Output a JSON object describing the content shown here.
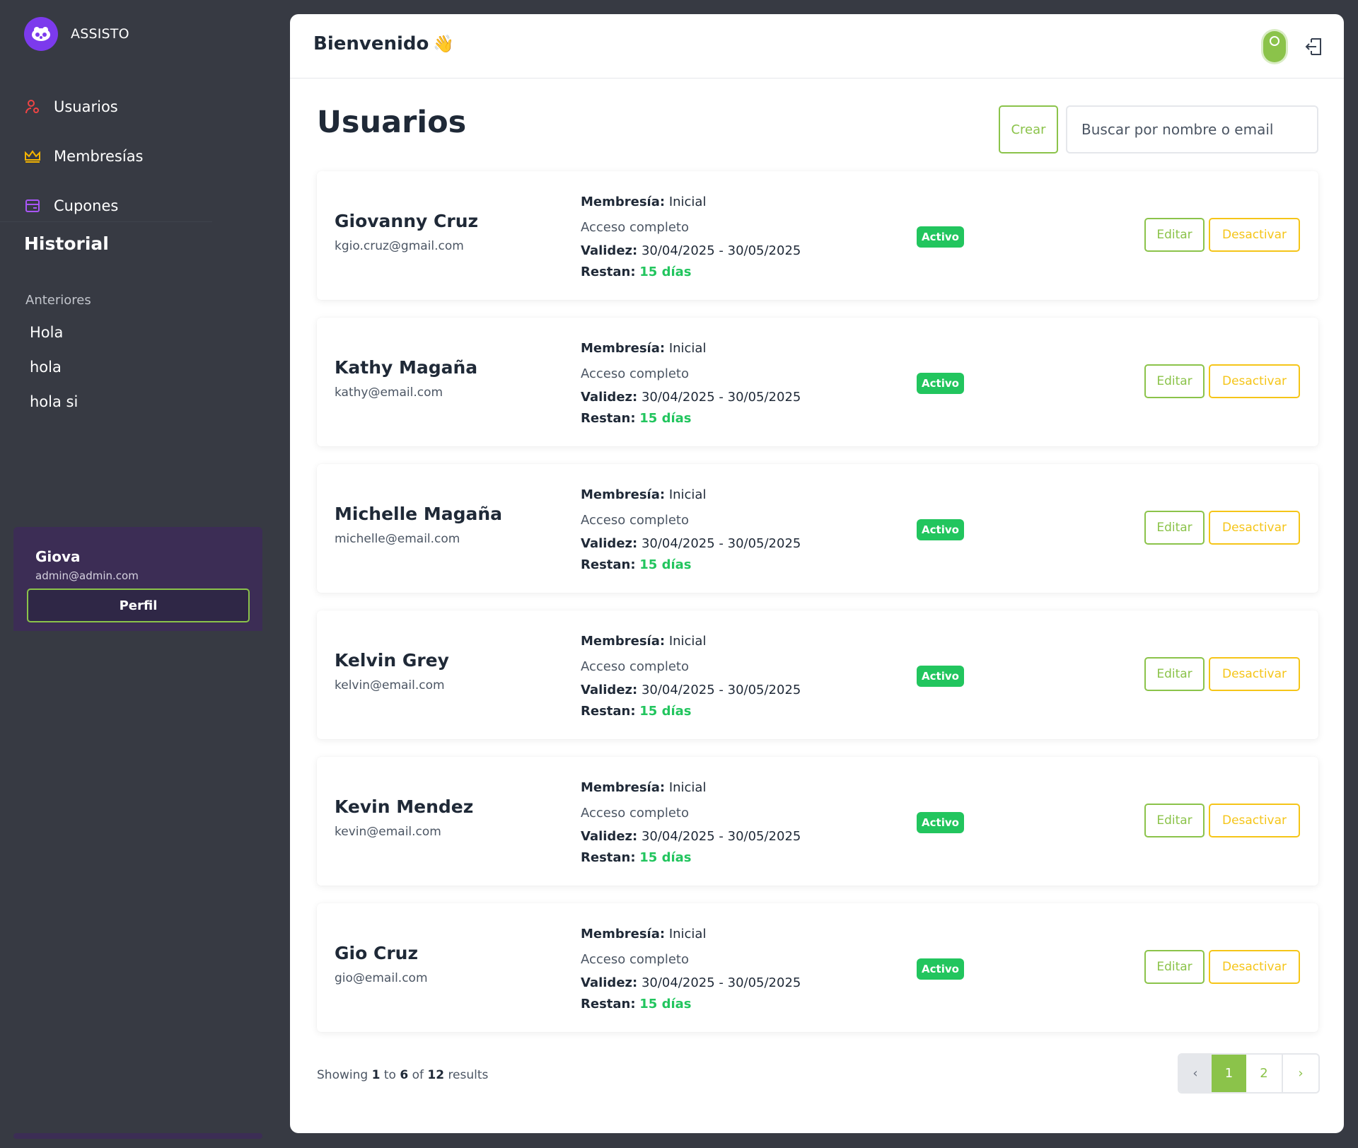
{
  "brand": {
    "name": "ASSISTO"
  },
  "sidebar": {
    "nav": [
      {
        "label": "Usuarios",
        "icon": "user-gear-icon"
      },
      {
        "label": "Membresías",
        "icon": "crown-icon"
      },
      {
        "label": "Cupones",
        "icon": "coupon-icon"
      }
    ],
    "history": {
      "title": "Historial",
      "subtitle": "Anteriores",
      "items": [
        "Hola",
        "hola",
        "hola si"
      ]
    },
    "user": {
      "name": "Giova",
      "email": "admin@admin.com",
      "profile_label": "Perfil"
    }
  },
  "header": {
    "welcome": "Bienvenido",
    "emoji": "👋"
  },
  "main": {
    "title": "Usuarios",
    "create_label": "Crear",
    "search_placeholder": "Buscar por nombre o email",
    "labels": {
      "membership": "Membresía:",
      "validity": "Validez:",
      "remaining": "Restan:",
      "edit": "Editar",
      "deactivate": "Desactivar"
    },
    "users": [
      {
        "name": "Giovanny Cruz",
        "email": "kgio.cruz@gmail.com",
        "membership": "Inicial",
        "access": "Acceso completo",
        "validity": "30/04/2025 - 30/05/2025",
        "remaining": "15 días",
        "status": "Activo"
      },
      {
        "name": "Kathy Magaña",
        "email": "kathy@email.com",
        "membership": "Inicial",
        "access": "Acceso completo",
        "validity": "30/04/2025 - 30/05/2025",
        "remaining": "15 días",
        "status": "Activo"
      },
      {
        "name": "Michelle Magaña",
        "email": "michelle@email.com",
        "membership": "Inicial",
        "access": "Acceso completo",
        "validity": "30/04/2025 - 30/05/2025",
        "remaining": "15 días",
        "status": "Activo"
      },
      {
        "name": "Kelvin Grey",
        "email": "kelvin@email.com",
        "membership": "Inicial",
        "access": "Acceso completo",
        "validity": "30/04/2025 - 30/05/2025",
        "remaining": "15 días",
        "status": "Activo"
      },
      {
        "name": "Kevin Mendez",
        "email": "kevin@email.com",
        "membership": "Inicial",
        "access": "Acceso completo",
        "validity": "30/04/2025 - 30/05/2025",
        "remaining": "15 días",
        "status": "Activo"
      },
      {
        "name": "Gio Cruz",
        "email": "gio@email.com",
        "membership": "Inicial",
        "access": "Acceso completo",
        "validity": "30/04/2025 - 30/05/2025",
        "remaining": "15 días",
        "status": "Activo"
      }
    ],
    "pagination": {
      "showing": "Showing",
      "from": "1",
      "to_word": "to",
      "to": "6",
      "of_word": "of",
      "total": "12",
      "results_word": "results",
      "prev": "‹",
      "pages": [
        "1",
        "2"
      ],
      "next": "›",
      "current_page": 1
    }
  },
  "colors": {
    "accent_green": "#8bc34a",
    "status_green": "#22c55e",
    "warning_yellow": "#f5c518",
    "sidebar_bg": "#373a43",
    "brand_purple": "#7c3aed"
  }
}
